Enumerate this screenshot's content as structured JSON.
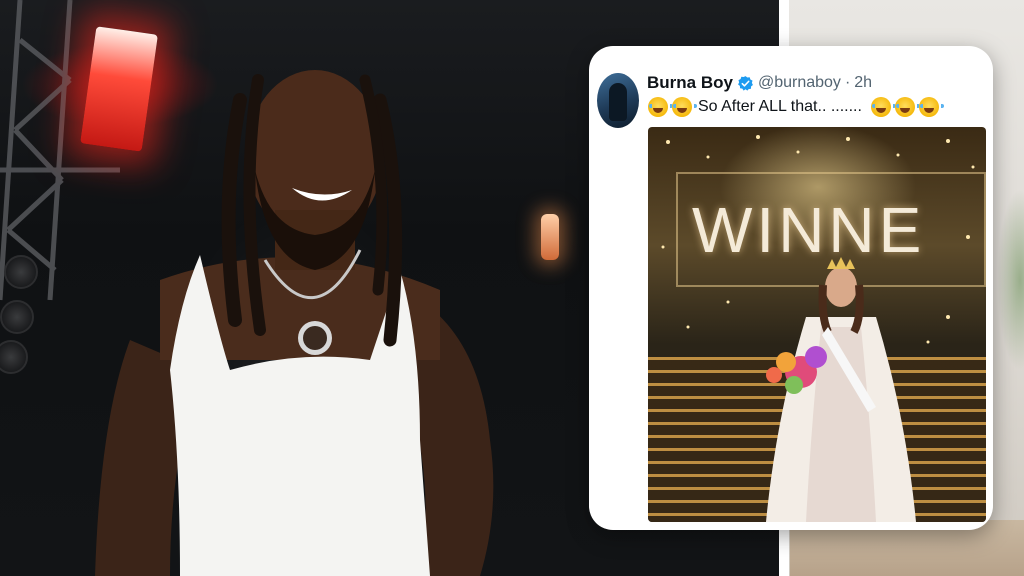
{
  "tweet": {
    "display_name": "Burna Boy",
    "handle": "@burnaboy",
    "separator": "·",
    "time": "2h",
    "text": "So After ALL that.. .......",
    "verified_color": "#1d9bf0",
    "media": {
      "banner_text": "WINNE"
    }
  },
  "colors": {
    "card_bg": "#ffffff",
    "name": "#0f1419",
    "secondary": "#536471",
    "accent": "#1d9bf0"
  },
  "icons": {
    "verified": "verified-badge-icon",
    "emoji": "face-with-tears-of-joy-icon"
  }
}
